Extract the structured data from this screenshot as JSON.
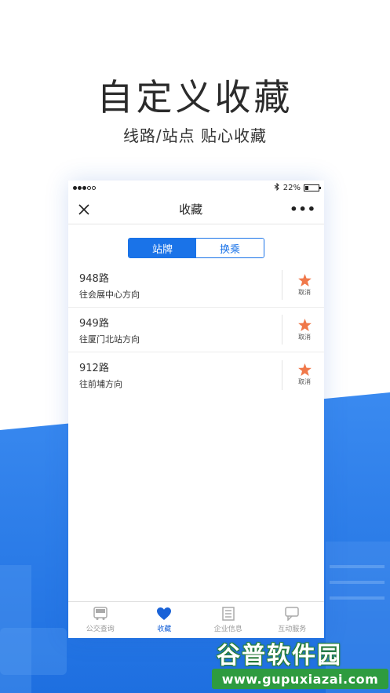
{
  "promo": {
    "headline": "自定义收藏",
    "subline": "线路/站点  贴心收藏"
  },
  "status_bar": {
    "battery": "22%",
    "battery_level": 0.22
  },
  "nav": {
    "title": "收藏"
  },
  "segment": {
    "tabs": [
      {
        "label": "站牌",
        "active": true
      },
      {
        "label": "换乘",
        "active": false
      }
    ]
  },
  "favorites": [
    {
      "route": "948路",
      "direction": "往会展中心方向",
      "action": "取消"
    },
    {
      "route": "949路",
      "direction": "往厦门北站方向",
      "action": "取消"
    },
    {
      "route": "912路",
      "direction": "往前埔方向",
      "action": "取消"
    }
  ],
  "tab_bar": {
    "items": [
      {
        "label": "公交查询",
        "icon": "bus-icon",
        "active": false
      },
      {
        "label": "收藏",
        "icon": "heart-icon",
        "active": true
      },
      {
        "label": "企业信息",
        "icon": "building-icon",
        "active": false
      },
      {
        "label": "互动服务",
        "icon": "chat-icon",
        "active": false
      }
    ]
  },
  "watermark": {
    "title": "谷普软件园",
    "url": "www.gupuxiazai.com"
  },
  "colors": {
    "accent": "#1a73e8",
    "star": "#f0784a",
    "background_blue": "#2b7de9",
    "watermark_green": "#2e9b3f"
  }
}
